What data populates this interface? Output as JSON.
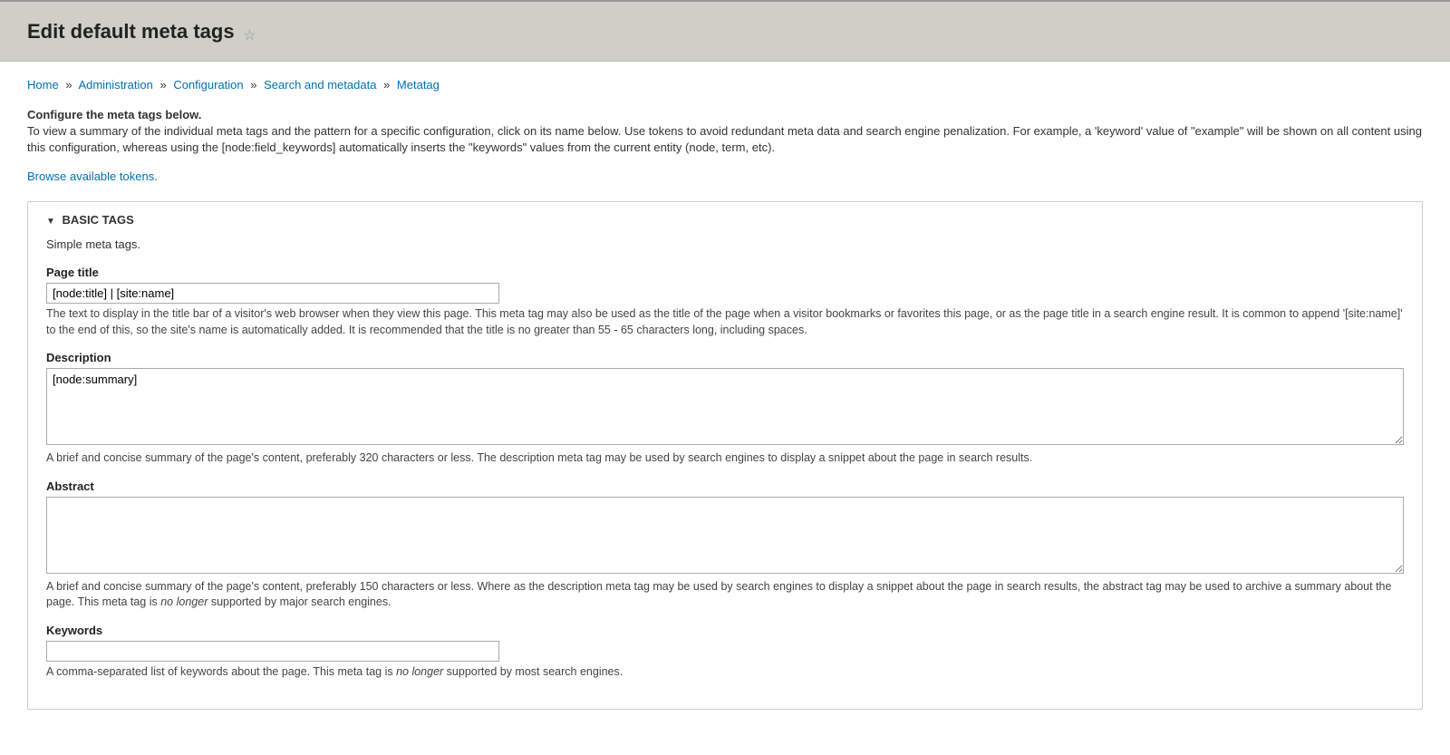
{
  "header": {
    "title": "Edit default meta tags"
  },
  "breadcrumb": {
    "items": [
      {
        "label": "Home"
      },
      {
        "label": "Administration"
      },
      {
        "label": "Configuration"
      },
      {
        "label": "Search and metadata"
      },
      {
        "label": "Metatag"
      }
    ],
    "separator": "»"
  },
  "intro": {
    "heading": "Configure the meta tags below.",
    "body": "To view a summary of the individual meta tags and the pattern for a specific configuration, click on its name below. Use tokens to avoid redundant meta data and search engine penalization. For example, a 'keyword' value of \"example\" will be shown on all content using this configuration, whereas using the [node:field_keywords] automatically inserts the \"keywords\" values from the current entity (node, term, etc)."
  },
  "tokens_link": "Browse available tokens.",
  "fieldset": {
    "legend": "BASIC TAGS",
    "description": "Simple meta tags.",
    "fields": {
      "page_title": {
        "label": "Page title",
        "value": "[node:title] | [site:name]",
        "help": "The text to display in the title bar of a visitor's web browser when they view this page. This meta tag may also be used as the title of the page when a visitor bookmarks or favorites this page, or as the page title in a search engine result. It is common to append '[site:name]' to the end of this, so the site's name is automatically added. It is recommended that the title is no greater than 55 - 65 characters long, including spaces."
      },
      "description": {
        "label": "Description",
        "value": "[node:summary]",
        "help": "A brief and concise summary of the page's content, preferably 320 characters or less. The description meta tag may be used by search engines to display a snippet about the page in search results."
      },
      "abstract": {
        "label": "Abstract",
        "value": "",
        "help_before": "A brief and concise summary of the page's content, preferably 150 characters or less. Where as the description meta tag may be used by search engines to display a snippet about the page in search results, the abstract tag may be used to archive a summary about the page. This meta tag is ",
        "help_em": "no longer",
        "help_after": " supported by major search engines."
      },
      "keywords": {
        "label": "Keywords",
        "value": "",
        "help_before": "A comma-separated list of keywords about the page. This meta tag is ",
        "help_em": "no longer",
        "help_after": " supported by most search engines."
      }
    }
  }
}
